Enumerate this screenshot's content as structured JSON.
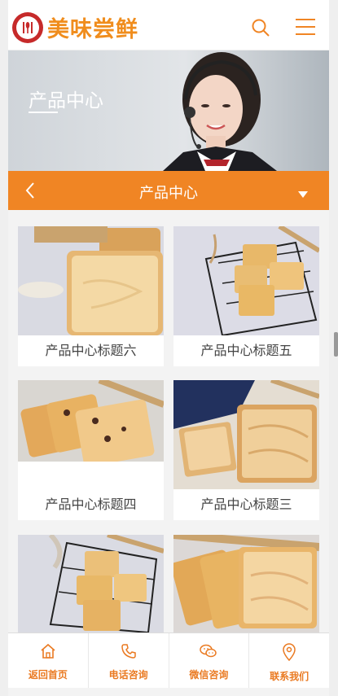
{
  "header": {
    "brand": "美味尝鲜",
    "search_icon": "search-icon",
    "menu_icon": "menu-icon"
  },
  "banner": {
    "title": "产品中心"
  },
  "category_bar": {
    "title": "产品中心",
    "back_icon": "chevron-left-icon",
    "dropdown_icon": "caret-down-icon"
  },
  "products": [
    {
      "title": "产品中心标题六"
    },
    {
      "title": "产品中心标题五"
    },
    {
      "title": "产品中心标题四"
    },
    {
      "title": "产品中心标题三"
    },
    {
      "title": ""
    },
    {
      "title": ""
    }
  ],
  "tabbar": {
    "items": [
      {
        "label": "返回首页",
        "icon": "home-icon"
      },
      {
        "label": "电话咨询",
        "icon": "phone-icon"
      },
      {
        "label": "微信咨询",
        "icon": "wechat-icon"
      },
      {
        "label": "联系我们",
        "icon": "location-icon"
      }
    ]
  },
  "colors": {
    "accent": "#f08524",
    "brand_text": "#f08d1d",
    "logo_red": "#c62a2a"
  }
}
